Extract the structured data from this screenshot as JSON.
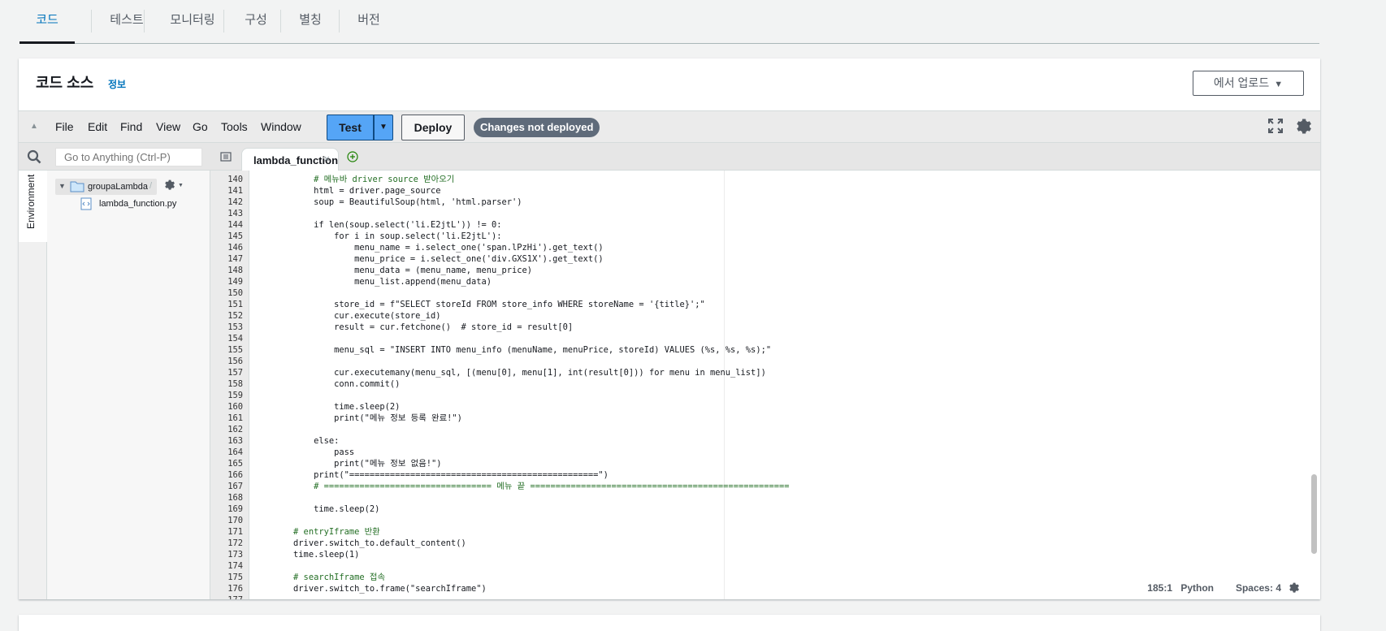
{
  "tabs": [
    {
      "label": "코드",
      "active": true
    },
    {
      "label": "테스트"
    },
    {
      "label": "모니터링"
    },
    {
      "label": "구성"
    },
    {
      "label": "별칭"
    },
    {
      "label": "버전"
    }
  ],
  "panel": {
    "title": "코드 소스",
    "info_link": "정보",
    "upload_button": "에서 업로드"
  },
  "toolbar": {
    "menu": [
      "File",
      "Edit",
      "Find",
      "View",
      "Go",
      "Tools",
      "Window"
    ],
    "test_label": "Test",
    "deploy_label": "Deploy",
    "status_badge": "Changes not deployed"
  },
  "sidebar": {
    "search_placeholder": "Go to Anything (Ctrl-P)",
    "env_tab": "Environment",
    "root_folder": "groupaLambda",
    "root_slash": "/",
    "file": "lambda_function.py"
  },
  "editor": {
    "open_tab": "lambda_function",
    "close_glyph": "×",
    "lines": [
      {
        "n": "140",
        "t": "            # 메뉴바 driver source 받아오기"
      },
      {
        "n": "141",
        "t": "            html = driver.page_source"
      },
      {
        "n": "142",
        "t": "            soup = BeautifulSoup(html, 'html.parser')"
      },
      {
        "n": "143",
        "t": ""
      },
      {
        "n": "144",
        "t": "            if len(soup.select('li.E2jtL')) != 0:"
      },
      {
        "n": "145",
        "t": "                for i in soup.select('li.E2jtL'):"
      },
      {
        "n": "146",
        "t": "                    menu_name = i.select_one('span.lPzHi').get_text()"
      },
      {
        "n": "147",
        "t": "                    menu_price = i.select_one('div.GXS1X').get_text()"
      },
      {
        "n": "148",
        "t": "                    menu_data = (menu_name, menu_price)"
      },
      {
        "n": "149",
        "t": "                    menu_list.append(menu_data)"
      },
      {
        "n": "150",
        "t": ""
      },
      {
        "n": "151",
        "t": "                store_id = f\"SELECT storeId FROM store_info WHERE storeName = '{title}';\""
      },
      {
        "n": "152",
        "t": "                cur.execute(store_id)"
      },
      {
        "n": "153",
        "t": "                result = cur.fetchone()  # store_id = result[0]"
      },
      {
        "n": "154",
        "t": ""
      },
      {
        "n": "155",
        "t": "                menu_sql = \"INSERT INTO menu_info (menuName, menuPrice, storeId) VALUES (%s, %s, %s);\""
      },
      {
        "n": "156",
        "t": ""
      },
      {
        "n": "157",
        "t": "                cur.executemany(menu_sql, [(menu[0], menu[1], int(result[0])) for menu in menu_list])"
      },
      {
        "n": "158",
        "t": "                conn.commit()"
      },
      {
        "n": "159",
        "t": ""
      },
      {
        "n": "160",
        "t": "                time.sleep(2)"
      },
      {
        "n": "161",
        "t": "                print(\"메뉴 정보 등록 완료!\")"
      },
      {
        "n": "162",
        "t": ""
      },
      {
        "n": "163",
        "t": "            else:"
      },
      {
        "n": "164",
        "t": "                pass"
      },
      {
        "n": "165",
        "t": "                print(\"메뉴 정보 없음!\")"
      },
      {
        "n": "166",
        "t": "            print(\"=================================================\")"
      },
      {
        "n": "167",
        "t": "            # ================================= 메뉴 끝 ==================================================="
      },
      {
        "n": "168",
        "t": ""
      },
      {
        "n": "169",
        "t": "            time.sleep(2)"
      },
      {
        "n": "170",
        "t": ""
      },
      {
        "n": "171",
        "t": "        # entryIframe 반환"
      },
      {
        "n": "172",
        "t": "        driver.switch_to.default_content()"
      },
      {
        "n": "173",
        "t": "        time.sleep(1)"
      },
      {
        "n": "174",
        "t": ""
      },
      {
        "n": "175",
        "t": "        # searchIframe 접속"
      },
      {
        "n": "176",
        "t": "        driver.switch_to.frame(\"searchIframe\")"
      },
      {
        "n": "177",
        "t": ""
      }
    ]
  },
  "status": {
    "position": "185:1",
    "language": "Python",
    "spaces": "Spaces: 4"
  },
  "colors": {
    "accent": "#0073bb",
    "test_button": "#55a5f6",
    "badge": "#5f6b7a",
    "string": "#1a1aa6",
    "comment": "#236e24",
    "keyword": "#0000ff"
  }
}
